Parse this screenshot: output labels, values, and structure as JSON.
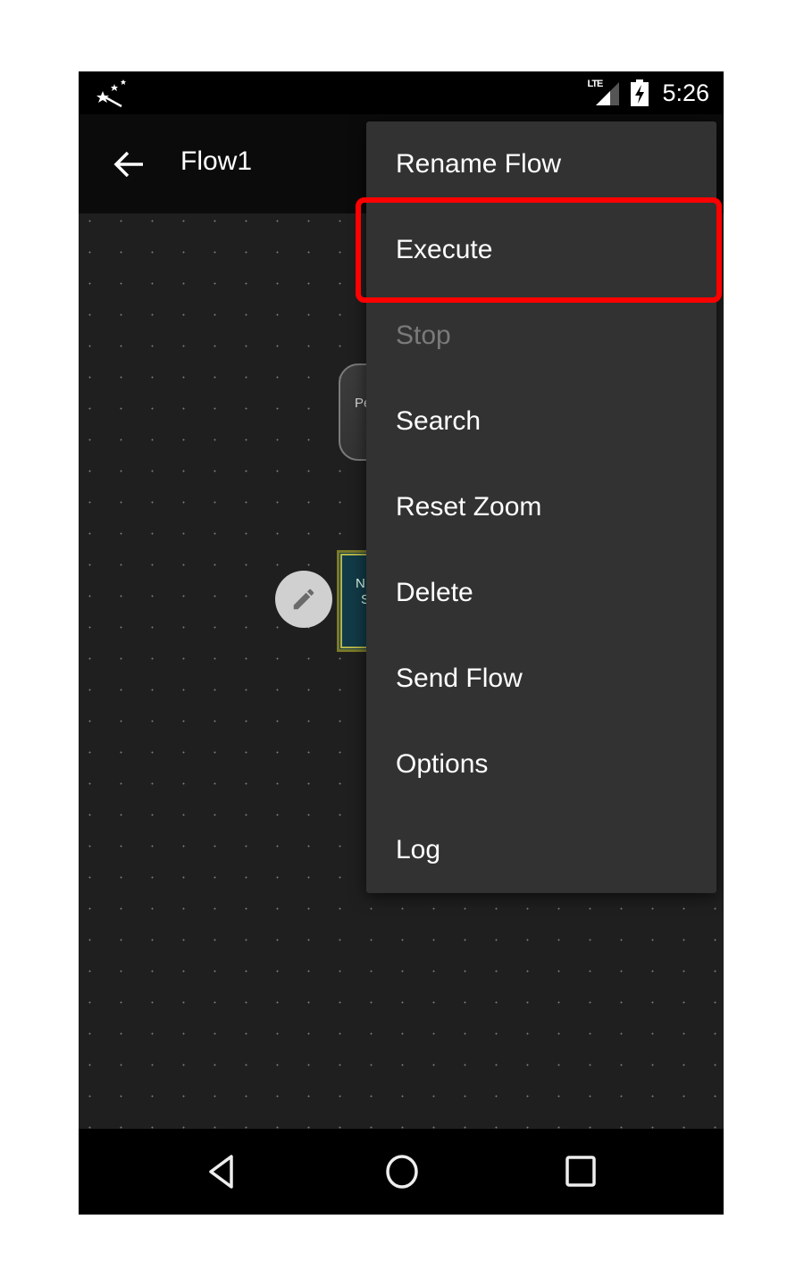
{
  "status_bar": {
    "app_icon": "magic-wand-icon",
    "network_label": "LTE",
    "signal_icon": "signal-icon",
    "battery_icon": "battery-charging-icon",
    "time": "5:26"
  },
  "app_bar": {
    "back_icon": "arrow-back-icon",
    "title": "Flow1"
  },
  "canvas": {
    "nodes": [
      {
        "label": "Pe"
      },
      {
        "label_line1": "N",
        "label_line2": "S"
      }
    ],
    "edit_icon": "pencil-icon"
  },
  "overflow_menu": {
    "items": [
      {
        "label": "Rename Flow",
        "enabled": true
      },
      {
        "label": "Execute",
        "enabled": true,
        "highlighted": true
      },
      {
        "label": "Stop",
        "enabled": false
      },
      {
        "label": "Search",
        "enabled": true
      },
      {
        "label": "Reset Zoom",
        "enabled": true
      },
      {
        "label": "Delete",
        "enabled": true
      },
      {
        "label": "Send Flow",
        "enabled": true
      },
      {
        "label": "Options",
        "enabled": true
      },
      {
        "label": "Log",
        "enabled": true
      }
    ]
  },
  "nav_bar": {
    "back": "nav-back-icon",
    "home": "nav-home-icon",
    "recents": "nav-recents-icon"
  },
  "colors": {
    "highlight": "#ff0000",
    "menu_bg": "#323232",
    "canvas_bg": "#1f1f1f",
    "disabled_text": "#7a7a7a"
  }
}
